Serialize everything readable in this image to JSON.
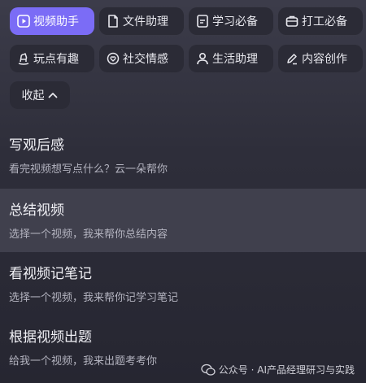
{
  "chips": [
    {
      "label": "视频助手",
      "icon": "video-play-icon",
      "active": true
    },
    {
      "label": "文件助理",
      "icon": "file-icon",
      "active": false
    },
    {
      "label": "学习必备",
      "icon": "notebook-icon",
      "active": false
    },
    {
      "label": "打工必备",
      "icon": "briefcase-icon",
      "active": false
    },
    {
      "label": "玩点有趣",
      "icon": "toy-horse-icon",
      "active": false
    },
    {
      "label": "社交情感",
      "icon": "heart-chat-icon",
      "active": false
    },
    {
      "label": "生活助理",
      "icon": "person-icon",
      "active": false
    },
    {
      "label": "内容创作",
      "icon": "pen-icon",
      "active": false
    }
  ],
  "collapse_label": "收起",
  "items": [
    {
      "title": "写观后感",
      "desc": "看完视频想写点什么？云一朵帮你"
    },
    {
      "title": "总结视频",
      "desc": "选择一个视频，我来帮你总结内容"
    },
    {
      "title": "看视频记笔记",
      "desc": "选择一个视频，我来帮你记学习笔记"
    },
    {
      "title": "根据视频出题",
      "desc": "给我一个视频，我来出题考考你"
    }
  ],
  "watermark": "公众号 · AI产品经理研习与实践",
  "colors": {
    "accent": "#7b6cf6",
    "chip_bg": "#2b2b36",
    "hover_row": "#40404d"
  }
}
